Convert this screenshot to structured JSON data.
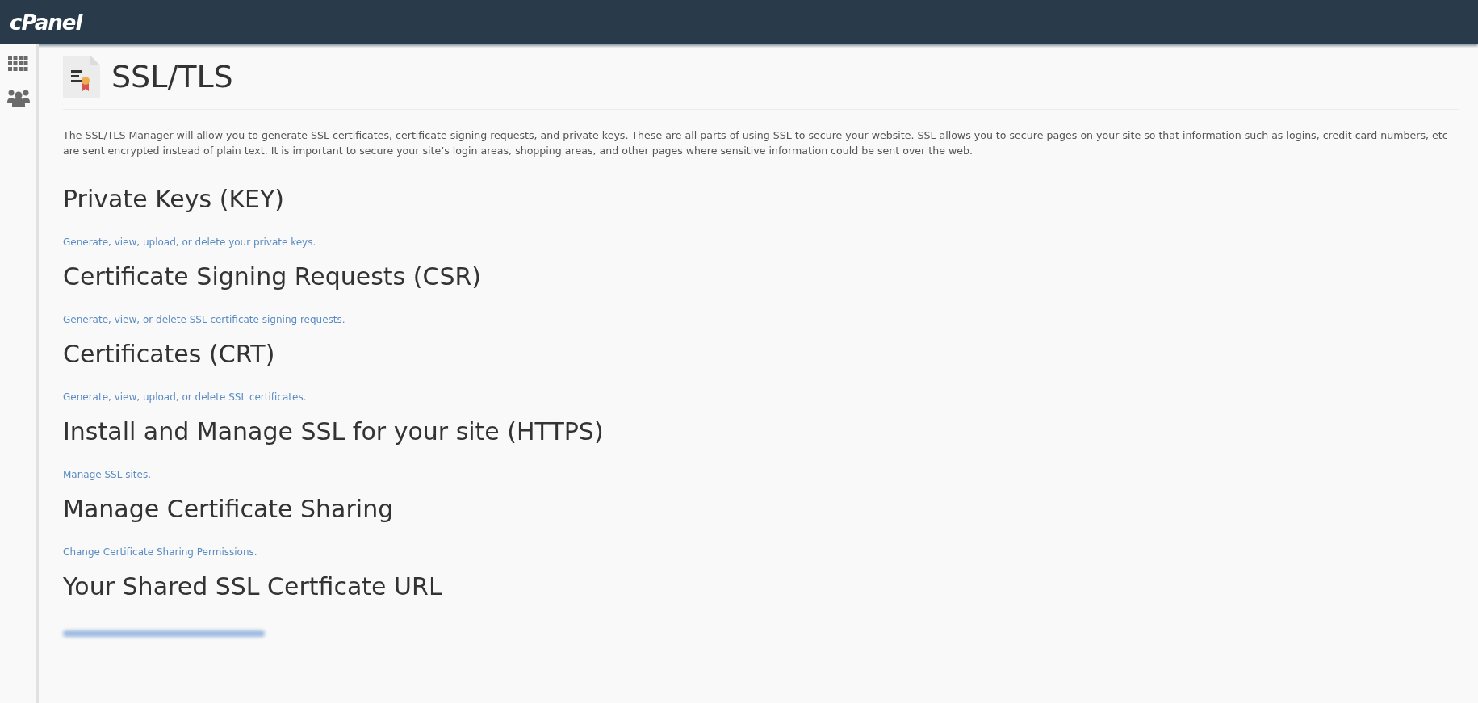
{
  "header": {
    "logo": "cPanel"
  },
  "sidebar": {
    "items": [
      {
        "kind": "apps"
      },
      {
        "kind": "users"
      }
    ]
  },
  "page": {
    "title": "SSL/TLS",
    "description": "The SSL/TLS Manager will allow you to generate SSL certificates, certificate signing requests, and private keys. These are all parts of using SSL to secure your website. SSL allows you to secure pages on your site so that information such as logins, credit card numbers, etc are sent encrypted instead of plain text. It is important to secure your site’s login areas, shopping areas, and other pages where sensitive information could be sent over the web."
  },
  "sections": [
    {
      "heading": "Private Keys (KEY)",
      "link": "Generate, view, upload, or delete your private keys."
    },
    {
      "heading": "Certificate Signing Requests (CSR)",
      "link": "Generate, view, or delete SSL certificate signing requests."
    },
    {
      "heading": "Certificates (CRT)",
      "link": "Generate, view, upload, or delete SSL certificates."
    },
    {
      "heading": "Install and Manage SSL for your site (HTTPS)",
      "link": "Manage SSL sites."
    },
    {
      "heading": "Manage Certificate Sharing",
      "link": "Change Certificate Sharing Permissions."
    },
    {
      "heading": "Your Shared SSL Certficate URL",
      "kind": "blurred"
    }
  ]
}
